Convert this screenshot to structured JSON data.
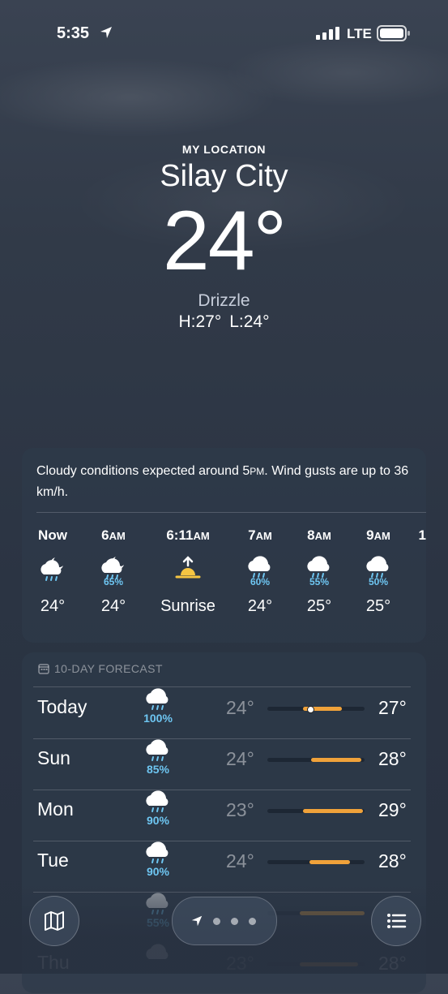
{
  "status_bar": {
    "time": "5:35",
    "network": "LTE"
  },
  "location": {
    "label": "MY LOCATION",
    "city": "Silay City"
  },
  "current": {
    "temp": "24°",
    "condition": "Drizzle",
    "high": "H:27°",
    "low": "L:24°"
  },
  "summary": {
    "text_before": "Cloudy conditions expected around 5",
    "pm": "PM",
    "text_after": ". Wind gusts are up to 36 km/h."
  },
  "hourly": [
    {
      "hour": "Now",
      "suffix": "",
      "icon": "cloud-moon-rain-icon",
      "pct": "",
      "temp": "24°"
    },
    {
      "hour": "6",
      "suffix": "AM",
      "icon": "cloud-moon-rain-icon",
      "pct": "65%",
      "temp": "24°"
    },
    {
      "hour": "6:11",
      "suffix": "AM",
      "icon": "sunrise-icon",
      "pct": "",
      "temp": "Sunrise"
    },
    {
      "hour": "7",
      "suffix": "AM",
      "icon": "cloud-rain-icon",
      "pct": "60%",
      "temp": "24°"
    },
    {
      "hour": "8",
      "suffix": "AM",
      "icon": "cloud-rain-icon",
      "pct": "55%",
      "temp": "25°"
    },
    {
      "hour": "9",
      "suffix": "AM",
      "icon": "cloud-rain-icon",
      "pct": "50%",
      "temp": "25°"
    },
    {
      "hour": "1",
      "suffix": "",
      "icon": "",
      "pct": "",
      "temp": ""
    }
  ],
  "forecast": {
    "header": "10-DAY FORECAST",
    "days": [
      {
        "day": "Today",
        "icon": "cloud-rain-icon",
        "pct": "100%",
        "low": "24°",
        "high": "27°",
        "current_temp_marker": 24
      },
      {
        "day": "Sun",
        "icon": "cloud-rain-icon",
        "pct": "85%",
        "low": "24°",
        "high": "28°"
      },
      {
        "day": "Mon",
        "icon": "cloud-rain-icon",
        "pct": "90%",
        "low": "23°",
        "high": "29°"
      },
      {
        "day": "Tue",
        "icon": "cloud-rain-icon",
        "pct": "90%",
        "low": "24°",
        "high": "28°"
      },
      {
        "day": "",
        "icon": "cloud-rain-icon",
        "pct": "55%",
        "low": "",
        "high": ""
      },
      {
        "day": "Thu",
        "icon": "cloud-rain-icon",
        "pct": "",
        "low": "23°",
        "high": "28°"
      }
    ]
  },
  "colors": {
    "accent_bar": "#f0a23a",
    "precip": "#6ec6f2"
  }
}
